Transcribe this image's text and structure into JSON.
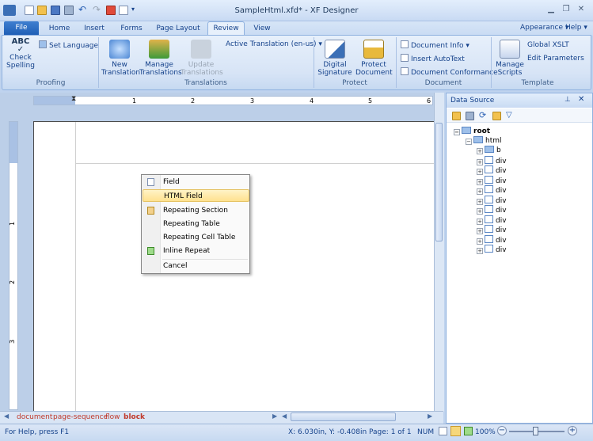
{
  "window": {
    "title": "SampleHtml.xfd* - XF Designer",
    "controls": [
      "minimize-icon",
      "restore-icon",
      "close-icon"
    ]
  },
  "tabs": {
    "file": "File",
    "items": [
      "Home",
      "Insert",
      "Forms",
      "Page Layout",
      "Review",
      "View"
    ],
    "active": "Review",
    "appearance": "Appearance",
    "help": "Help"
  },
  "ribbon": {
    "proofing": {
      "label": "Proofing",
      "check_spelling": "Check\nSpelling",
      "set_language": "Set Language"
    },
    "translations": {
      "label": "Translations",
      "new": "New\nTranslation",
      "manage": "Manage\nTranslations",
      "update": "Update\nTranslations",
      "active": "Active Translation (en-us)"
    },
    "protect": {
      "label": "Protect",
      "digital_signature": "Digital\nSignature",
      "protect_document": "Protect\nDocument"
    },
    "document": {
      "label": "Document",
      "document_info": "Document Info",
      "insert_autotext": "Insert AutoText",
      "document_conformance": "Document Conformance"
    },
    "template": {
      "label": "Template",
      "manage_scripts": "Manage\nScripts",
      "global_xslt": "Global XSLT",
      "edit_parameters": "Edit Parameters"
    }
  },
  "ruler": {
    "h_ticks": [
      "1",
      "2",
      "3",
      "4",
      "5",
      "6"
    ],
    "v_ticks": [
      "1",
      "2",
      "3"
    ]
  },
  "context_menu": {
    "items": [
      {
        "label": "Field",
        "icon": "field-icon",
        "highlighted": false
      },
      {
        "label": "HTML Field",
        "icon": "",
        "highlighted": true
      },
      {
        "label": "Repeating Section",
        "icon": "repeating-section-icon",
        "highlighted": false
      },
      {
        "label": "Repeating Table",
        "icon": "",
        "highlighted": false
      },
      {
        "label": "Repeating Cell Table",
        "icon": "",
        "highlighted": false
      },
      {
        "label": "Inline Repeat",
        "icon": "inline-repeat-icon",
        "highlighted": false
      },
      {
        "label": "Cancel",
        "icon": "",
        "highlighted": false
      }
    ]
  },
  "breadcrumb": [
    "document",
    "page-sequence",
    "flow",
    "block"
  ],
  "data_source": {
    "title": "Data Source",
    "tree": {
      "root": "root",
      "html": "html",
      "children": [
        "b",
        "div",
        "div",
        "div",
        "div",
        "div",
        "div",
        "div",
        "div",
        "div",
        "div"
      ]
    }
  },
  "statusbar": {
    "help": "For Help, press F1",
    "position": "X: 6.030in, Y: -0.408in Page: 1 of 1",
    "num": "NUM",
    "zoom": "100%"
  }
}
